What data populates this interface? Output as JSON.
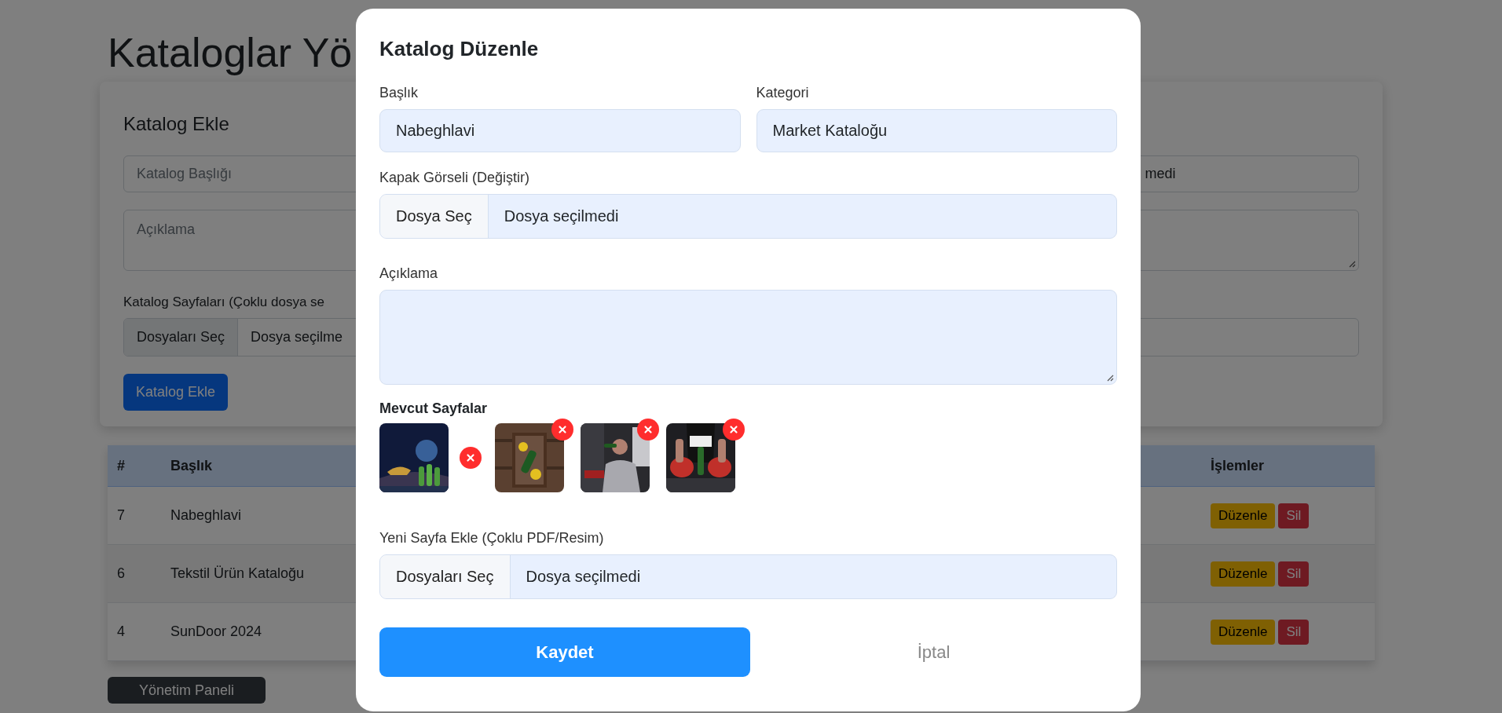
{
  "page": {
    "title": "Kataloglar Yö"
  },
  "add_form": {
    "title": "Katalog Ekle",
    "title_field": {
      "placeholder": "Katalog Başlığı"
    },
    "field_2": {
      "value": "medi"
    },
    "description_field": {
      "placeholder": "Açıklama"
    },
    "pages_label": "Katalog Sayfaları (Çoklu dosya se",
    "pages_file": {
      "button": "Dosyaları Seç",
      "value": "Dosya seçilme"
    },
    "submit": "Katalog Ekle"
  },
  "table": {
    "columns": [
      "#",
      "Başlık",
      "İşlemler"
    ],
    "rows": [
      {
        "id": "7",
        "title": "Nabeghlavi",
        "edit": "Düzenle",
        "delete": "Sil"
      },
      {
        "id": "6",
        "title": "Tekstil Ürün Kataloğu",
        "edit": "Düzenle",
        "delete": "Sil"
      },
      {
        "id": "4",
        "title": "SunDoor 2024",
        "edit": "Düzenle",
        "delete": "Sil"
      }
    ]
  },
  "panel_button": "Yönetim Paneli",
  "edit_modal": {
    "title": "Katalog Düzenle",
    "fields": [
      {
        "label": "Başlık",
        "value": "Nabeghlavi"
      },
      {
        "label": "Kategori",
        "value": "Market Kataloğu"
      }
    ],
    "cover": {
      "label": "Kapak Görseli (Değiştir)",
      "button": "Dosya Seç",
      "value": "Dosya seçilmedi"
    },
    "description": {
      "label": "Açıklama"
    },
    "existing_pages": {
      "label": "Mevcut Sayfalar"
    },
    "new_pages": {
      "label": "Yeni Sayfa Ekle (Çoklu PDF/Resim)",
      "button": "Dosyaları Seç",
      "value": "Dosya seçilmedi"
    },
    "save": "Kaydet",
    "cancel": "İptal"
  }
}
